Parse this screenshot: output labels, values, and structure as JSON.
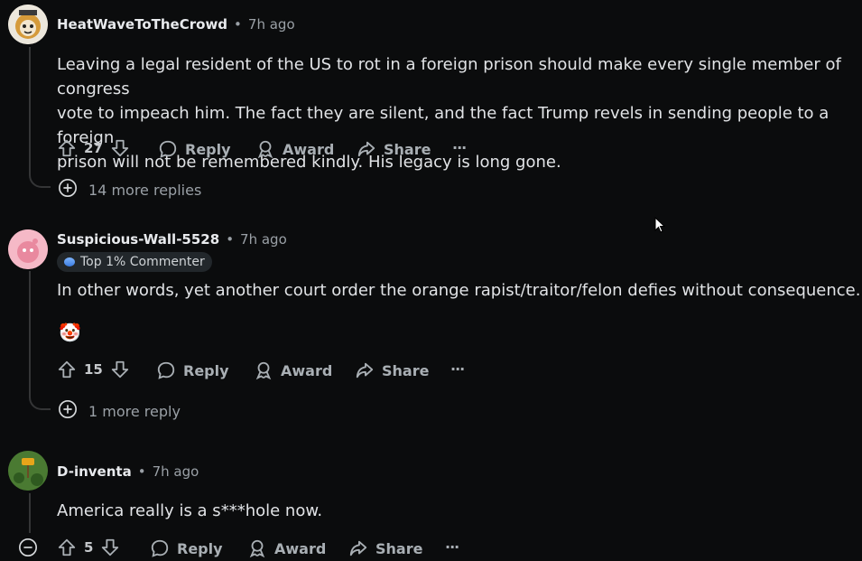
{
  "comments": [
    {
      "author": "HeatWaveToTheCrowd",
      "time": "7h ago",
      "lines": [
        "Leaving a legal resident of the US to rot in a foreign prison should make every single member of congress",
        "vote to impeach him. The fact they are silent, and the fact Trump revels in sending people to a foreign",
        "prison will not be remembered kindly. His legacy is long gone."
      ],
      "votes": "27",
      "more_replies": "14 more replies"
    },
    {
      "author": "Suspicious-Wall-5528",
      "time": "7h ago",
      "badge": "Top 1% Commenter",
      "lines": [
        "In other words, yet another court order the orange rapist/traitor/felon defies without consequence."
      ],
      "emoji": "🤡",
      "votes": "15",
      "more_replies": "1 more reply"
    },
    {
      "author": "D-inventa",
      "time": "7h ago",
      "lines": [
        "America really is a s***hole now."
      ],
      "votes": "5"
    }
  ],
  "actions": {
    "reply": "Reply",
    "award": "Award",
    "share": "Share",
    "more": "···"
  },
  "separator": "•",
  "icons": [
    "upvote-icon",
    "downvote-icon",
    "reply-icon",
    "award-icon",
    "share-icon",
    "overflow-icon",
    "plus-circle-icon",
    "collapse-icon",
    "cursor-icon"
  ],
  "colors": {
    "background": "#0b0c0d",
    "text": "#e1e3e6",
    "muted": "#9aa0a6",
    "thread_line": "#343536"
  }
}
